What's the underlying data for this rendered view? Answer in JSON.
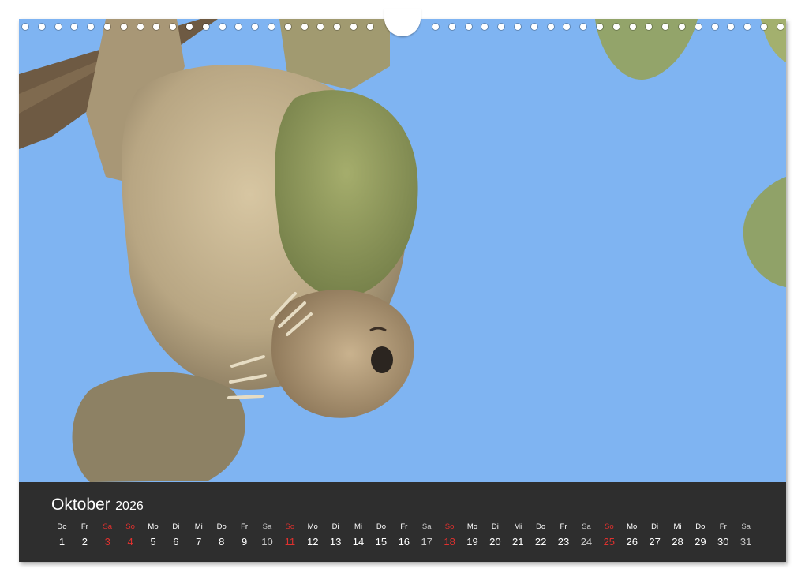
{
  "calendar": {
    "month": "Oktober",
    "year": "2026",
    "days": [
      {
        "wd": "Do",
        "num": "1",
        "type": "weekday"
      },
      {
        "wd": "Fr",
        "num": "2",
        "type": "weekday"
      },
      {
        "wd": "Sa",
        "num": "3",
        "type": "sun"
      },
      {
        "wd": "So",
        "num": "4",
        "type": "sun"
      },
      {
        "wd": "Mo",
        "num": "5",
        "type": "weekday"
      },
      {
        "wd": "Di",
        "num": "6",
        "type": "weekday"
      },
      {
        "wd": "Mi",
        "num": "7",
        "type": "weekday"
      },
      {
        "wd": "Do",
        "num": "8",
        "type": "weekday"
      },
      {
        "wd": "Fr",
        "num": "9",
        "type": "weekday"
      },
      {
        "wd": "Sa",
        "num": "10",
        "type": "sat"
      },
      {
        "wd": "So",
        "num": "11",
        "type": "sun"
      },
      {
        "wd": "Mo",
        "num": "12",
        "type": "weekday"
      },
      {
        "wd": "Di",
        "num": "13",
        "type": "weekday"
      },
      {
        "wd": "Mi",
        "num": "14",
        "type": "weekday"
      },
      {
        "wd": "Do",
        "num": "15",
        "type": "weekday"
      },
      {
        "wd": "Fr",
        "num": "16",
        "type": "weekday"
      },
      {
        "wd": "Sa",
        "num": "17",
        "type": "sat"
      },
      {
        "wd": "So",
        "num": "18",
        "type": "sun"
      },
      {
        "wd": "Mo",
        "num": "19",
        "type": "weekday"
      },
      {
        "wd": "Di",
        "num": "20",
        "type": "weekday"
      },
      {
        "wd": "Mi",
        "num": "21",
        "type": "weekday"
      },
      {
        "wd": "Do",
        "num": "22",
        "type": "weekday"
      },
      {
        "wd": "Fr",
        "num": "23",
        "type": "weekday"
      },
      {
        "wd": "Sa",
        "num": "24",
        "type": "sat"
      },
      {
        "wd": "So",
        "num": "25",
        "type": "sun"
      },
      {
        "wd": "Mo",
        "num": "26",
        "type": "weekday"
      },
      {
        "wd": "Di",
        "num": "27",
        "type": "weekday"
      },
      {
        "wd": "Mi",
        "num": "28",
        "type": "weekday"
      },
      {
        "wd": "Do",
        "num": "29",
        "type": "weekday"
      },
      {
        "wd": "Fr",
        "num": "30",
        "type": "weekday"
      },
      {
        "wd": "Sa",
        "num": "31",
        "type": "sat"
      }
    ]
  },
  "photo": {
    "subject": "sloth-illustration",
    "colors": {
      "sky": "#7fb4f2",
      "fur": "#bfae8c",
      "fur_dark": "#8d7c5c",
      "moss": "#8e9a5a",
      "branch": "#6e5a43",
      "leaf": "#93a46a"
    }
  },
  "colors": {
    "calendar_bg": "#2e2e2e",
    "text": "#ffffff",
    "sunday": "#e0312e",
    "saturday": "#c9c9c9"
  },
  "binding": {
    "ring_icon": "ring-icon",
    "hanger_icon": "hanger-icon"
  }
}
